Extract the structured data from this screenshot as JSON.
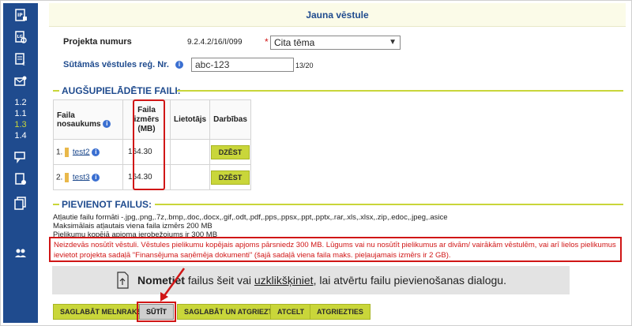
{
  "header": {
    "title": "Jauna vēstule"
  },
  "rail": {
    "icons": [
      "ip-document-icon",
      "search-document-icon",
      "euro-document-icon",
      "mail-settings-icon",
      "chat-icon",
      "document-gear-icon",
      "documents-stack-icon",
      "users-icon"
    ],
    "numbers": [
      "1.2",
      "1.1",
      "1.3",
      "1.4"
    ],
    "active_number": "1.3"
  },
  "form": {
    "project_label": "Projekta numurs",
    "project_value": "9.2.4.2/16/I/099",
    "required_mark": "*",
    "topic_value": "Cita tēma",
    "reg_label": "Sūtāmās vēstules reģ. Nr.",
    "reg_value": "abc-123",
    "reg_count": "13/20"
  },
  "uploaded": {
    "title": "AUGŠUPIELĀDĒTIE FAILI:",
    "columns": {
      "name": "Faila nosaukums",
      "size_line1": "Faila",
      "size_line2": "izmērs",
      "size_line3": "(MB)",
      "user": "Lietotājs",
      "actions": "Darbības"
    },
    "rows": [
      {
        "index": "1.",
        "name": "test2",
        "size": "164.30",
        "action": "DZĒST"
      },
      {
        "index": "2.",
        "name": "test3",
        "size": "164.30",
        "action": "DZĒST"
      }
    ]
  },
  "attach": {
    "title": "PIEVIENOT FAILUS:",
    "formats": "Atļautie failu formāti -.jpg,.png,.7z,.bmp,.doc,.docx,.gif,.odt,.pdf,.pps,.ppsx,.ppt,.pptx,.rar,.xls,.xlsx,.zip,.edoc,.jpeg,.asice",
    "max_size": "Maksimālais atļautais viena faila izmērs 200 MB",
    "total_limit": "Pielikumu kopējā apjoma ierobežojums ir 300 MB",
    "error_line1": "Neizdevās nosūtīt vēstuli. Vēstules pielikumu kopējais apjoms pārsniedz 300 MB. Lūgums vai nu nosūtīt pielikumus ar divām/ vairākām vēstulēm, vai arī lielos pielikumus",
    "error_line2": "ievietot projekta sadaļā \"Finansējuma saņēmēja dokumenti\" (šajā sadaļā viena faila maks. pieļaujamais izmērs ir 2 GB).",
    "drop_bold": "Nometiet",
    "drop_mid": " failus šeit vai ",
    "drop_link": "uzklikšķiniet",
    "drop_end": ", lai atvērtu failu pievienošanas dialogu."
  },
  "buttons": {
    "save_draft": "SAGLABĀT MELNRAKSTU",
    "send": "SŪTĪT",
    "save_return": "SAGLABĀT UN ATGRIEZTIES",
    "cancel": "ATCELT",
    "back": "ATGRIEZTIES"
  },
  "colors": {
    "brand_blue": "#1f4b8e",
    "accent_green": "#c9d63a",
    "error_red": "#d01616"
  }
}
